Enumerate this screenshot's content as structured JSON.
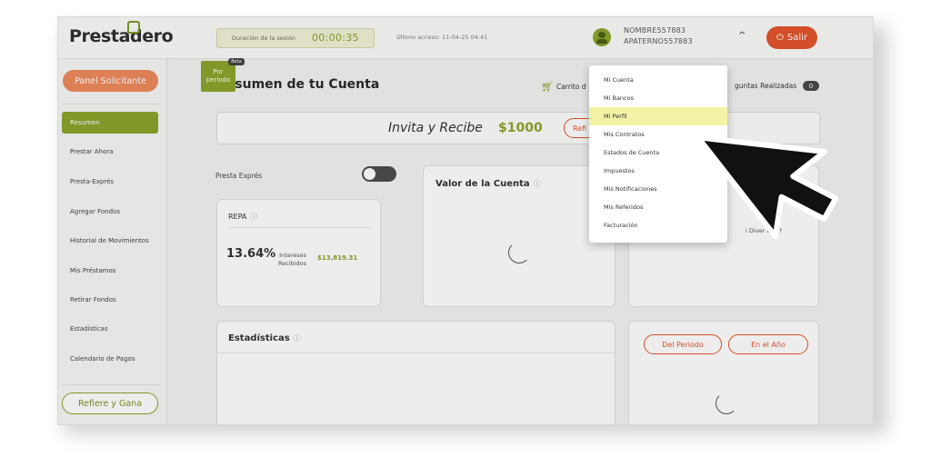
{
  "header": {
    "logo": "Prestadero",
    "session_label": "Duración de la sesión",
    "session_time": "00:00:35",
    "last_access": "Último acceso: 11-04-25 04:41",
    "user_name": "NOMBRE557883",
    "user_surname": "APATERNO557883",
    "logout_label": "Salir"
  },
  "sidebar": {
    "panel_button": "Panel Solicitante",
    "items": [
      {
        "label": "Resumen"
      },
      {
        "label": "Prestar Ahora"
      },
      {
        "label": "Presta-Exprés"
      },
      {
        "label": "Agregar Fondos"
      },
      {
        "label": "Historial de Movimientos"
      },
      {
        "label": "Mis Préstamos"
      },
      {
        "label": "Retirar Fondos"
      },
      {
        "label": "Estadísticas"
      },
      {
        "label": "Calendario de Pagos"
      }
    ],
    "refer_button": "Refiere y Gana"
  },
  "main": {
    "title": "Resumen de tu Cuenta",
    "cart_label": "Carrito d",
    "questions_label": "guntas Realizadas",
    "questions_count": "0",
    "banner": {
      "text": "Invita y Recibe",
      "amount": "$1000",
      "button": "Refi"
    },
    "presta_expres_label": "Presta Exprés",
    "repa": {
      "title": "REPA",
      "percent": "13.64%",
      "interest_line1": "Intereses",
      "interest_line2": "Recibidos",
      "amount": "$13,819.31",
      "period_line1": "Por",
      "period_line2": "periodo",
      "beta": "Beta"
    },
    "valor_title": "Valor de la Cuenta",
    "right_card_text": "i Diver   ción?",
    "stats_title": "Estadísticas",
    "period_buttons": [
      "Del Periodo",
      "En el Año"
    ]
  },
  "dropdown": {
    "items": [
      {
        "label": "Mi Cuenta"
      },
      {
        "label": "Mi Bancos"
      },
      {
        "label": "Mi Perfil"
      },
      {
        "label": "Mis Contratos"
      },
      {
        "label": "Estados de Cuenta"
      },
      {
        "label": "Impuestos"
      },
      {
        "label": "Mis Notificaciones"
      },
      {
        "label": "Mis Referidos"
      },
      {
        "label": "Facturación"
      }
    ],
    "highlighted_index": 2
  },
  "icons": {
    "help": "?",
    "cart": "🛒",
    "chevron_up": "^",
    "power": "⏻"
  },
  "colors": {
    "brand_green": "#8aa52c",
    "accent_orange": "#e2562d",
    "panel_orange": "#ee8a5c",
    "highlight_yellow": "#f3f3a6"
  }
}
